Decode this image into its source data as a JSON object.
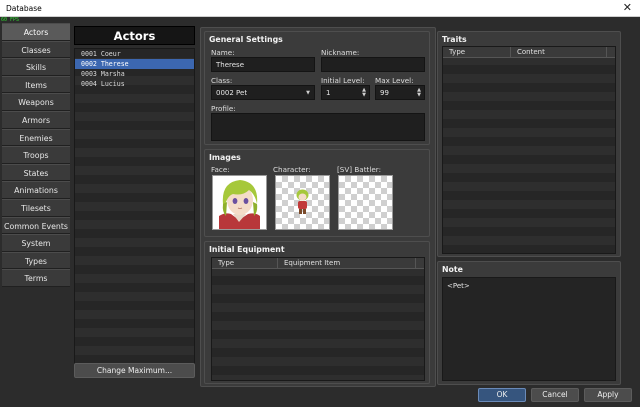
{
  "window": {
    "title": "Database",
    "fps": "60 FPS"
  },
  "categories": [
    {
      "label": "Actors",
      "active": true
    },
    {
      "label": "Classes"
    },
    {
      "label": "Skills"
    },
    {
      "label": "Items"
    },
    {
      "label": "Weapons"
    },
    {
      "label": "Armors"
    },
    {
      "label": "Enemies"
    },
    {
      "label": "Troops"
    },
    {
      "label": "States"
    },
    {
      "label": "Animations"
    },
    {
      "label": "Tilesets"
    },
    {
      "label": "Common Events"
    },
    {
      "label": "System"
    },
    {
      "label": "Types"
    },
    {
      "label": "Terms"
    }
  ],
  "actors_panel": {
    "title": "Actors",
    "items": [
      {
        "label": "0001 Coeur"
      },
      {
        "label": "0002 Therese",
        "selected": true
      },
      {
        "label": "0003 Marsha"
      },
      {
        "label": "0004 Lucius"
      }
    ],
    "change_maximum_label": "Change Maximum..."
  },
  "general": {
    "title": "General Settings",
    "name_label": "Name:",
    "name_value": "Therese",
    "nickname_label": "Nickname:",
    "nickname_value": "",
    "class_label": "Class:",
    "class_value": "0002 Pet",
    "initial_level_label": "Initial Level:",
    "initial_level_value": "1",
    "max_level_label": "Max Level:",
    "max_level_value": "99",
    "profile_label": "Profile:",
    "profile_value": ""
  },
  "images": {
    "title": "Images",
    "face_label": "Face:",
    "character_label": "Character:",
    "battler_label": "[SV] Battler:"
  },
  "equipment": {
    "title": "Initial Equipment",
    "col_type": "Type",
    "col_item": "Equipment Item"
  },
  "traits": {
    "title": "Traits",
    "col_type": "Type",
    "col_content": "Content"
  },
  "note": {
    "title": "Note",
    "value": "<Pet>"
  },
  "footer": {
    "ok_label": "OK",
    "cancel_label": "Cancel",
    "apply_label": "Apply"
  },
  "colors": {
    "selection": "#3c67b0",
    "panel": "#3b3b3b",
    "field": "#1f1f1f",
    "fps": "#2fdc2f"
  },
  "icons": {
    "close": "close-icon",
    "dropdown": "chevron-down-icon",
    "spinner": "spinner-arrows-icon"
  }
}
